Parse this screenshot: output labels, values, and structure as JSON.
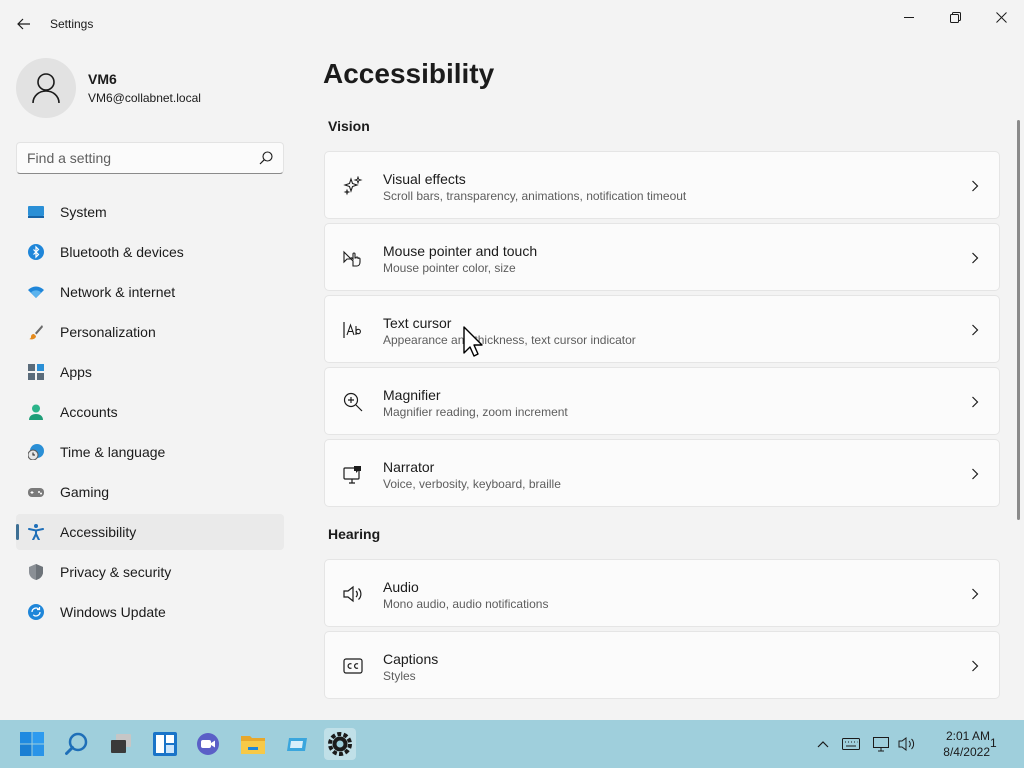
{
  "window": {
    "title": "Settings"
  },
  "profile": {
    "name": "VM6",
    "email": "VM6@collabnet.local"
  },
  "search": {
    "placeholder": "Find a setting"
  },
  "sidebar": {
    "items": [
      {
        "label": "System",
        "icon": "system-icon"
      },
      {
        "label": "Bluetooth & devices",
        "icon": "bluetooth-icon"
      },
      {
        "label": "Network & internet",
        "icon": "wifi-icon"
      },
      {
        "label": "Personalization",
        "icon": "paintbrush-icon"
      },
      {
        "label": "Apps",
        "icon": "apps-icon"
      },
      {
        "label": "Accounts",
        "icon": "accounts-icon"
      },
      {
        "label": "Time & language",
        "icon": "clock-globe-icon"
      },
      {
        "label": "Gaming",
        "icon": "gamepad-icon"
      },
      {
        "label": "Accessibility",
        "icon": "accessibility-icon",
        "selected": true
      },
      {
        "label": "Privacy & security",
        "icon": "shield-icon"
      },
      {
        "label": "Windows Update",
        "icon": "update-icon"
      }
    ]
  },
  "main": {
    "title": "Accessibility",
    "sections": [
      {
        "heading": "Vision",
        "cards": [
          {
            "title": "Visual effects",
            "subtitle": "Scroll bars, transparency, animations, notification timeout",
            "icon": "sparkle-icon"
          },
          {
            "title": "Mouse pointer and touch",
            "subtitle": "Mouse pointer color, size",
            "icon": "pointer-touch-icon"
          },
          {
            "title": "Text cursor",
            "subtitle": "Appearance and thickness, text cursor indicator",
            "icon": "text-cursor-icon"
          },
          {
            "title": "Magnifier",
            "subtitle": "Magnifier reading, zoom increment",
            "icon": "magnifier-icon"
          },
          {
            "title": "Narrator",
            "subtitle": "Voice, verbosity, keyboard, braille",
            "icon": "narrator-icon"
          }
        ]
      },
      {
        "heading": "Hearing",
        "cards": [
          {
            "title": "Audio",
            "subtitle": "Mono audio, audio notifications",
            "icon": "speaker-icon"
          },
          {
            "title": "Captions",
            "subtitle": "Styles",
            "icon": "captions-icon"
          }
        ]
      }
    ]
  },
  "taskbar": {
    "apps": [
      "start-icon",
      "search-icon",
      "task-view-icon",
      "widgets-icon",
      "teams-chat-icon",
      "file-explorer-icon",
      "store-icon",
      "settings-icon"
    ],
    "time": "2:01 AM",
    "date": "8/4/2022",
    "notification_count": "1"
  },
  "colors": {
    "accent": "#3d6f94",
    "taskbar": "#9fcfdc",
    "background": "#f3f3f3"
  }
}
